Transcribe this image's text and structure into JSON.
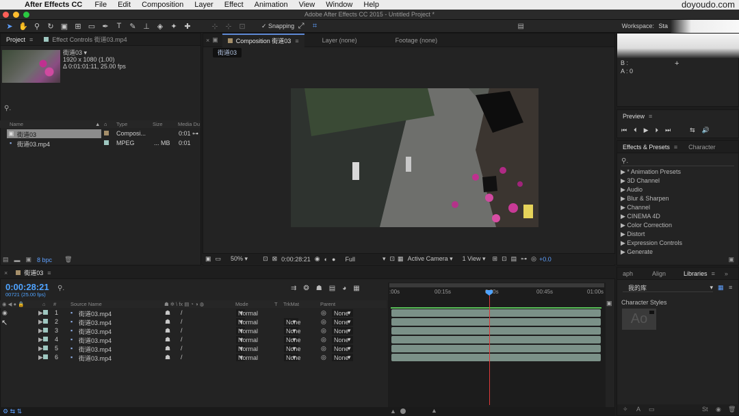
{
  "menubar": {
    "app_name": "After Effects CC",
    "items": [
      "File",
      "Edit",
      "Composition",
      "Layer",
      "Effect",
      "Animation",
      "View",
      "Window",
      "Help"
    ],
    "brand": "doyoudo.com"
  },
  "window": {
    "title": "Adobe After Effects CC 2015 - Untitled Project *"
  },
  "toolbar": {
    "snapping_label": "Snapping",
    "snapping_checked": true,
    "workspace_label": "Workspace:",
    "workspace_value": "Sta"
  },
  "project_panel": {
    "tab_label": "Project",
    "effect_controls_label": "Effect Controls 街道03.mp4",
    "selected_item": {
      "name": "街道03 ▾",
      "resolution": "1920 x 1080 (1.00)",
      "duration": "Δ 0:01:01:11, 25.00 fps"
    },
    "columns": [
      "Name",
      "Type",
      "Size",
      "Media Du"
    ],
    "items": [
      {
        "name": "街道03",
        "type": "Composi...",
        "size": "",
        "duration": "0:01",
        "color": "#a58f6a",
        "selected": true
      },
      {
        "name": "街道03.mp4",
        "type": "MPEG",
        "size": "... MB",
        "duration": "0:01",
        "color": "#9ec7c0",
        "selected": false
      }
    ],
    "bpc_label": "8 bpc"
  },
  "composition_panel": {
    "tabs": [
      "Composition 街道03",
      "Layer (none)",
      "Footage (none)"
    ],
    "active_tag": "街道03",
    "footer": {
      "magnification": "50%",
      "timecode": "0:00:28:21",
      "resolution": "Full",
      "camera": "Active Camera",
      "view": "1 View",
      "exposure": "+0.0"
    }
  },
  "info_panel": {
    "b_label": "B :",
    "a_label": "A : 0"
  },
  "preview_panel": {
    "tab_label": "Preview"
  },
  "effects_panel": {
    "tabs": [
      "Effects & Presets",
      "Character"
    ],
    "items": [
      "* Animation Presets",
      "3D Channel",
      "Audio",
      "Blur & Sharpen",
      "Channel",
      "CINEMA 4D",
      "Color Correction",
      "Distort",
      "Expression Controls",
      "Generate"
    ]
  },
  "timeline": {
    "tab_label": "街道03",
    "timecode": "0:00:28:21",
    "frames": "00721 (25.00 fps)",
    "columns": {
      "source_name": "Source Name",
      "mode": "Mode",
      "t": "T",
      "trkmat": "TrkMat",
      "parent": "Parent"
    },
    "ruler_labels": [
      ":00s",
      "00:15s",
      "0:30s",
      "00:45s",
      "01:00s"
    ],
    "playhead_fraction": 0.47,
    "layers": [
      {
        "num": "1",
        "name": "街道03.mp4",
        "mode": "Normal",
        "trkmat": "",
        "parent": "None",
        "visible": true
      },
      {
        "num": "2",
        "name": "街道03.mp4",
        "mode": "Normal",
        "trkmat": "None",
        "parent": "None",
        "visible": false
      },
      {
        "num": "3",
        "name": "街道03.mp4",
        "mode": "Normal",
        "trkmat": "None",
        "parent": "None",
        "visible": false
      },
      {
        "num": "4",
        "name": "街道03.mp4",
        "mode": "Normal",
        "trkmat": "None",
        "parent": "None",
        "visible": false
      },
      {
        "num": "5",
        "name": "街道03.mp4",
        "mode": "Normal",
        "trkmat": "None",
        "parent": "None",
        "visible": false
      },
      {
        "num": "6",
        "name": "街道03.mp4",
        "mode": "Normal",
        "trkmat": "None",
        "parent": "None",
        "visible": false
      }
    ]
  },
  "libraries_panel": {
    "tabs": [
      "aph",
      "Align",
      "Libraries"
    ],
    "library_name": "我的库",
    "section_label": "Character Styles",
    "sample_text": "Ao"
  },
  "colors": {
    "accent": "#4fa3ff",
    "playhead": "#e03a3a",
    "layer_bar": "#7b9188",
    "layer_label": "#9ec7c0"
  }
}
